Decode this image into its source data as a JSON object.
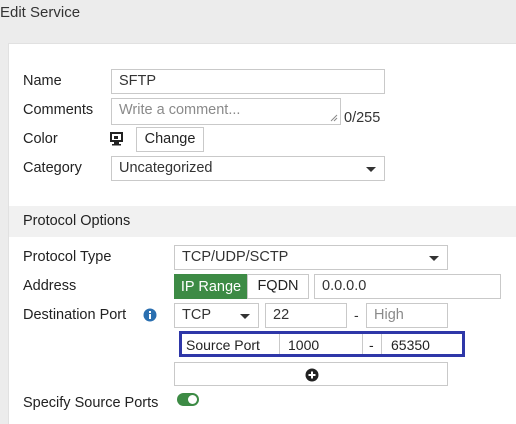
{
  "window": {
    "title": "Edit Service"
  },
  "form": {
    "name_label": "Name",
    "name_value": "SFTP",
    "comments_label": "Comments",
    "comments_placeholder": "Write a comment...",
    "comments_counter": "0/255",
    "color_label": "Color",
    "color_change_label": "Change",
    "category_label": "Category",
    "category_value": "Uncategorized"
  },
  "protocol": {
    "section_title": "Protocol Options",
    "type_label": "Protocol Type",
    "type_value": "TCP/UDP/SCTP",
    "address_label": "Address",
    "address_mode_iprange": "IP Range",
    "address_mode_fqdn": "FQDN",
    "address_value": "0.0.0.0",
    "address_active_mode": "IP Range",
    "dest_port_label": "Destination Port",
    "dest_protocol": "TCP",
    "dest_low": "22",
    "dest_high_placeholder": "High",
    "dest_range_separator": "-",
    "source_port_label": "Source Port",
    "source_low": "1000",
    "source_range_separator": "-",
    "source_high": "65350",
    "specify_source_ports_label": "Specify Source Ports",
    "specify_source_ports_enabled": true
  },
  "colors": {
    "accent_green": "#3d8b45",
    "highlight_blue": "#2e37a8"
  },
  "icons": {
    "color_swatch": "monitor-icon",
    "info": "info-icon",
    "add": "plus-circle-icon"
  }
}
